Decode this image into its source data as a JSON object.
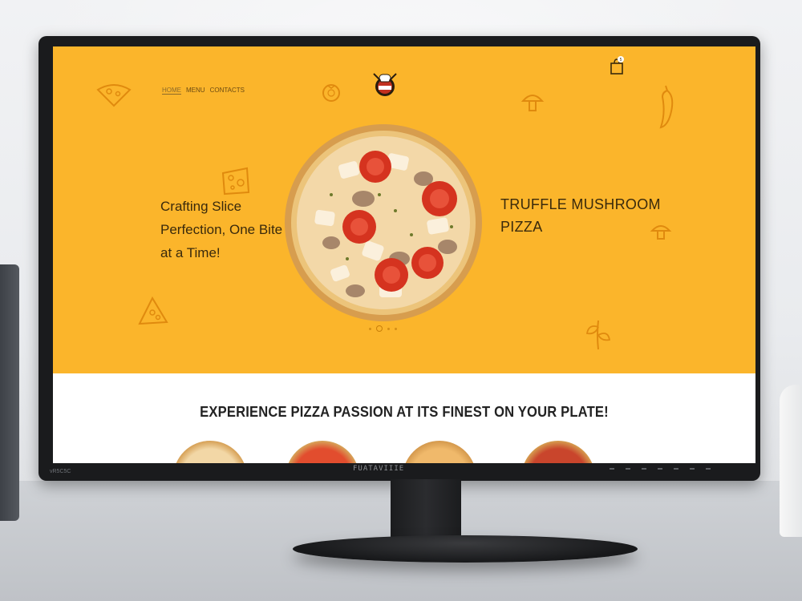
{
  "nav": {
    "items": [
      {
        "label": "HOME",
        "active": true
      },
      {
        "label": "MENU",
        "active": false
      },
      {
        "label": "CONTACTS",
        "active": false
      }
    ]
  },
  "header": {
    "logo_icon": "chef-hat-logo-icon",
    "cart_icon": "shopping-bag-icon",
    "cart_count": "5"
  },
  "hero": {
    "tagline": "Crafting Slice Perfection, One Bite at a Time!",
    "product_title": "TRUFFLE MUSHROOM PIZZA",
    "carousel_index": 1,
    "carousel_total": 4
  },
  "section": {
    "title": "EXPERIENCE PIZZA PASSION AT ITS FINEST ON YOUR PLATE!"
  },
  "monitor": {
    "brand": "FUATAVIIIE",
    "model": "vR5C5C"
  },
  "colors": {
    "hero_bg": "#fbb52b",
    "doodle": "#e08a0e",
    "text_dark": "#3a2a0c"
  }
}
